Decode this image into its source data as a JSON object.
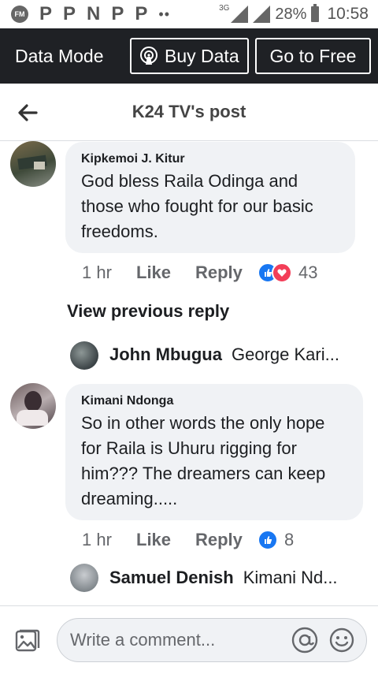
{
  "status_bar": {
    "fm_label": "FM",
    "icons": [
      "P",
      "P",
      "N",
      "P",
      "P"
    ],
    "dots": "••",
    "network": "3G",
    "battery_pct": "28%",
    "time": "10:58"
  },
  "data_bar": {
    "mode_label": "Data Mode",
    "buy_label": "Buy Data",
    "free_label": "Go to Free"
  },
  "header": {
    "title": "K24 TV's post"
  },
  "comments": [
    {
      "author": "Kipkemoi J. Kitur",
      "lines": [
        "God bless Raila Odinga and",
        "those who fought for our basic",
        "freedoms."
      ],
      "time": "1 hr",
      "like": "Like",
      "reply": "Reply",
      "reaction_count": "43"
    },
    {
      "author": "Kimani Ndonga",
      "lines": [
        "So in other words the only hope",
        "for Raila is Uhuru rigging for",
        "him??? The dreamers can keep",
        "dreaming....."
      ],
      "time": "1 hr",
      "like": "Like",
      "reply": "Reply",
      "reaction_count": "8"
    }
  ],
  "view_previous": "View previous reply",
  "replies": [
    {
      "name": "John Mbugua",
      "text": "George Kari..."
    },
    {
      "name": "Samuel Denish",
      "text": "Kimani Nd..."
    }
  ],
  "composer": {
    "placeholder": "Write a comment..."
  },
  "colors": {
    "like_blue": "#1877f2",
    "love_red": "#f33e58",
    "data_bar_bg": "#1f2125"
  }
}
